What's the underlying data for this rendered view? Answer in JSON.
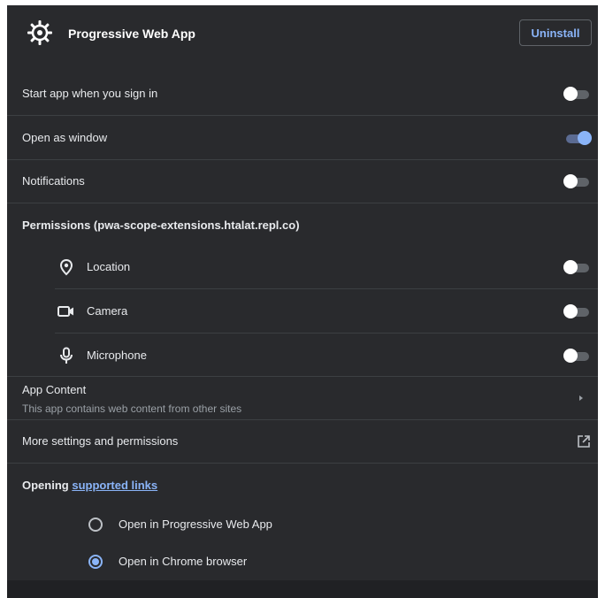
{
  "header": {
    "app_name": "Progressive Web App",
    "uninstall_label": "Uninstall",
    "app_icon": "gear-icon"
  },
  "settings": {
    "start_on_signin": {
      "label": "Start app when you sign in",
      "enabled": false
    },
    "open_as_window": {
      "label": "Open as window",
      "enabled": true
    },
    "notifications": {
      "label": "Notifications",
      "enabled": false
    }
  },
  "permissions": {
    "title": "Permissions (pwa-scope-extensions.htalat.repl.co)",
    "items": [
      {
        "label": "Location",
        "icon": "location-pin-icon",
        "enabled": false
      },
      {
        "label": "Camera",
        "icon": "camera-icon",
        "enabled": false
      },
      {
        "label": "Microphone",
        "icon": "microphone-icon",
        "enabled": false
      }
    ]
  },
  "app_content": {
    "title": "App Content",
    "subtitle": "This app contains web content from other sites",
    "icon": "chevron-right-icon"
  },
  "more_settings": {
    "label": "More settings and permissions",
    "icon": "open-external-icon"
  },
  "opening": {
    "prefix": "Opening",
    "link_text": "supported links",
    "options": [
      {
        "label": "Open in Progressive Web App",
        "selected": false
      },
      {
        "label": "Open in Chrome browser",
        "selected": true
      }
    ]
  },
  "colors": {
    "background": "#292a2d",
    "accent": "#8ab4f8",
    "divider": "#3c4043",
    "text": "#e8eaed",
    "secondary_text": "#9aa0a6"
  }
}
